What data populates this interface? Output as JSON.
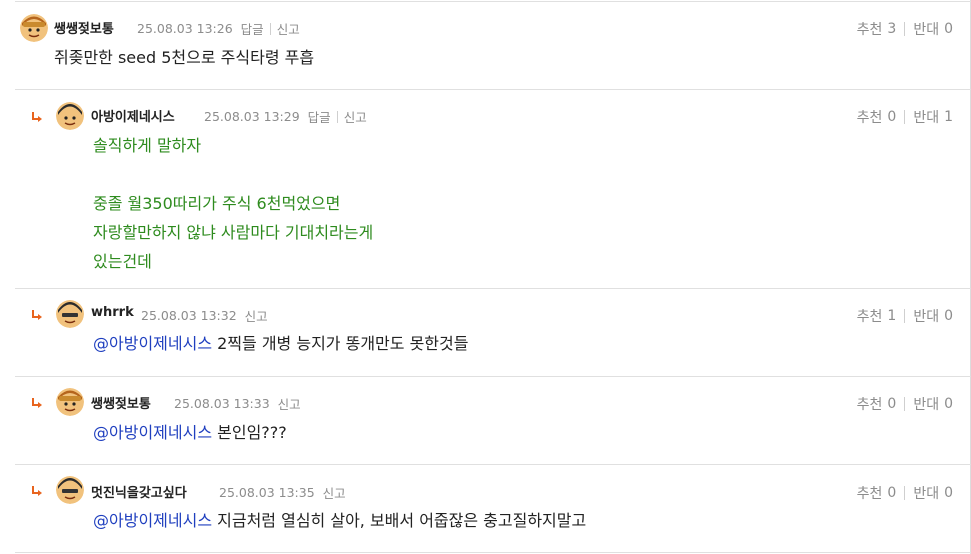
{
  "comments": [
    {
      "nick": "쌩쌩젖보통",
      "date": "25.08.03 13:26",
      "reply_label": "답글",
      "report_label": "신고",
      "up_label": "추천",
      "up_count": "3",
      "down_label": "반대",
      "down_count": "0",
      "text": "쥐좆만한 seed 5천으로 주식타령 푸흡"
    },
    {
      "nick": "아방이제네시스",
      "date": "25.08.03 13:29",
      "reply_label": "답글",
      "report_label": "신고",
      "up_label": "추천",
      "up_count": "0",
      "down_label": "반대",
      "down_count": "1",
      "lines": [
        "솔직하게 말하자",
        "",
        "중졸 월350따리가 주식 6천먹었으면",
        "자랑할만하지 않냐 사람마다 기대치라는게",
        "있는건데"
      ]
    },
    {
      "nick": "whrrk",
      "date": "25.08.03 13:32",
      "report_label": "신고",
      "up_label": "추천",
      "up_count": "1",
      "down_label": "반대",
      "down_count": "0",
      "mention": "@아방이제네시스",
      "text": " 2찍들 개병 능지가 똥개만도 못한것들"
    },
    {
      "nick": "쌩쌩젖보통",
      "date": "25.08.03 13:33",
      "report_label": "신고",
      "up_label": "추천",
      "up_count": "0",
      "down_label": "반대",
      "down_count": "0",
      "mention": "@아방이제네시스",
      "text": " 본인임???"
    },
    {
      "nick": "멋진닉을갖고싶다",
      "date": "25.08.03 13:35",
      "report_label": "신고",
      "up_label": "추천",
      "up_count": "0",
      "down_label": "반대",
      "down_count": "0",
      "mention": "@아방이제네시스",
      "text": " 지금처럼 열심히 살아, 보배서 어줍잖은 충고질하지말고"
    }
  ],
  "icons": {
    "reply_arrow": "reply-arrow-icon",
    "avatar": "avatar-icon"
  },
  "colors": {
    "reply_arrow": "#e8641e",
    "green_text": "#2e8b1e",
    "mention": "#1f3fbf",
    "meta": "#8c8c8c"
  }
}
